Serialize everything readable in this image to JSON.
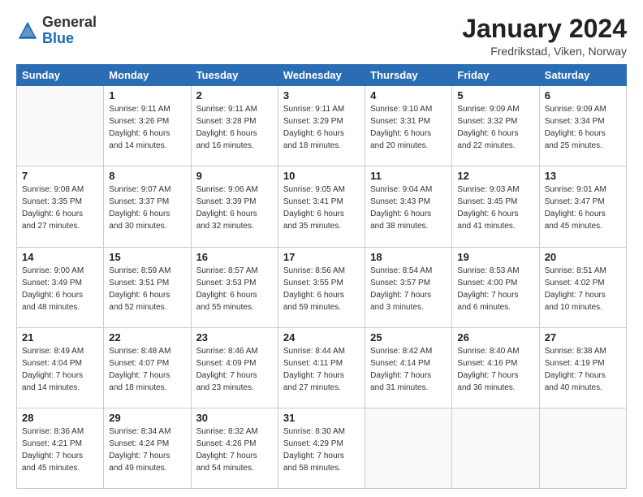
{
  "header": {
    "logo_general": "General",
    "logo_blue": "Blue",
    "month_title": "January 2024",
    "location": "Fredrikstad, Viken, Norway"
  },
  "weekdays": [
    "Sunday",
    "Monday",
    "Tuesday",
    "Wednesday",
    "Thursday",
    "Friday",
    "Saturday"
  ],
  "weeks": [
    [
      {
        "day": "",
        "info": ""
      },
      {
        "day": "1",
        "info": "Sunrise: 9:11 AM\nSunset: 3:26 PM\nDaylight: 6 hours\nand 14 minutes."
      },
      {
        "day": "2",
        "info": "Sunrise: 9:11 AM\nSunset: 3:28 PM\nDaylight: 6 hours\nand 16 minutes."
      },
      {
        "day": "3",
        "info": "Sunrise: 9:11 AM\nSunset: 3:29 PM\nDaylight: 6 hours\nand 18 minutes."
      },
      {
        "day": "4",
        "info": "Sunrise: 9:10 AM\nSunset: 3:31 PM\nDaylight: 6 hours\nand 20 minutes."
      },
      {
        "day": "5",
        "info": "Sunrise: 9:09 AM\nSunset: 3:32 PM\nDaylight: 6 hours\nand 22 minutes."
      },
      {
        "day": "6",
        "info": "Sunrise: 9:09 AM\nSunset: 3:34 PM\nDaylight: 6 hours\nand 25 minutes."
      }
    ],
    [
      {
        "day": "7",
        "info": "Sunrise: 9:08 AM\nSunset: 3:35 PM\nDaylight: 6 hours\nand 27 minutes."
      },
      {
        "day": "8",
        "info": "Sunrise: 9:07 AM\nSunset: 3:37 PM\nDaylight: 6 hours\nand 30 minutes."
      },
      {
        "day": "9",
        "info": "Sunrise: 9:06 AM\nSunset: 3:39 PM\nDaylight: 6 hours\nand 32 minutes."
      },
      {
        "day": "10",
        "info": "Sunrise: 9:05 AM\nSunset: 3:41 PM\nDaylight: 6 hours\nand 35 minutes."
      },
      {
        "day": "11",
        "info": "Sunrise: 9:04 AM\nSunset: 3:43 PM\nDaylight: 6 hours\nand 38 minutes."
      },
      {
        "day": "12",
        "info": "Sunrise: 9:03 AM\nSunset: 3:45 PM\nDaylight: 6 hours\nand 41 minutes."
      },
      {
        "day": "13",
        "info": "Sunrise: 9:01 AM\nSunset: 3:47 PM\nDaylight: 6 hours\nand 45 minutes."
      }
    ],
    [
      {
        "day": "14",
        "info": "Sunrise: 9:00 AM\nSunset: 3:49 PM\nDaylight: 6 hours\nand 48 minutes."
      },
      {
        "day": "15",
        "info": "Sunrise: 8:59 AM\nSunset: 3:51 PM\nDaylight: 6 hours\nand 52 minutes."
      },
      {
        "day": "16",
        "info": "Sunrise: 8:57 AM\nSunset: 3:53 PM\nDaylight: 6 hours\nand 55 minutes."
      },
      {
        "day": "17",
        "info": "Sunrise: 8:56 AM\nSunset: 3:55 PM\nDaylight: 6 hours\nand 59 minutes."
      },
      {
        "day": "18",
        "info": "Sunrise: 8:54 AM\nSunset: 3:57 PM\nDaylight: 7 hours\nand 3 minutes."
      },
      {
        "day": "19",
        "info": "Sunrise: 8:53 AM\nSunset: 4:00 PM\nDaylight: 7 hours\nand 6 minutes."
      },
      {
        "day": "20",
        "info": "Sunrise: 8:51 AM\nSunset: 4:02 PM\nDaylight: 7 hours\nand 10 minutes."
      }
    ],
    [
      {
        "day": "21",
        "info": "Sunrise: 8:49 AM\nSunset: 4:04 PM\nDaylight: 7 hours\nand 14 minutes."
      },
      {
        "day": "22",
        "info": "Sunrise: 8:48 AM\nSunset: 4:07 PM\nDaylight: 7 hours\nand 18 minutes."
      },
      {
        "day": "23",
        "info": "Sunrise: 8:46 AM\nSunset: 4:09 PM\nDaylight: 7 hours\nand 23 minutes."
      },
      {
        "day": "24",
        "info": "Sunrise: 8:44 AM\nSunset: 4:11 PM\nDaylight: 7 hours\nand 27 minutes."
      },
      {
        "day": "25",
        "info": "Sunrise: 8:42 AM\nSunset: 4:14 PM\nDaylight: 7 hours\nand 31 minutes."
      },
      {
        "day": "26",
        "info": "Sunrise: 8:40 AM\nSunset: 4:16 PM\nDaylight: 7 hours\nand 36 minutes."
      },
      {
        "day": "27",
        "info": "Sunrise: 8:38 AM\nSunset: 4:19 PM\nDaylight: 7 hours\nand 40 minutes."
      }
    ],
    [
      {
        "day": "28",
        "info": "Sunrise: 8:36 AM\nSunset: 4:21 PM\nDaylight: 7 hours\nand 45 minutes."
      },
      {
        "day": "29",
        "info": "Sunrise: 8:34 AM\nSunset: 4:24 PM\nDaylight: 7 hours\nand 49 minutes."
      },
      {
        "day": "30",
        "info": "Sunrise: 8:32 AM\nSunset: 4:26 PM\nDaylight: 7 hours\nand 54 minutes."
      },
      {
        "day": "31",
        "info": "Sunrise: 8:30 AM\nSunset: 4:29 PM\nDaylight: 7 hours\nand 58 minutes."
      },
      {
        "day": "",
        "info": ""
      },
      {
        "day": "",
        "info": ""
      },
      {
        "day": "",
        "info": ""
      }
    ]
  ]
}
